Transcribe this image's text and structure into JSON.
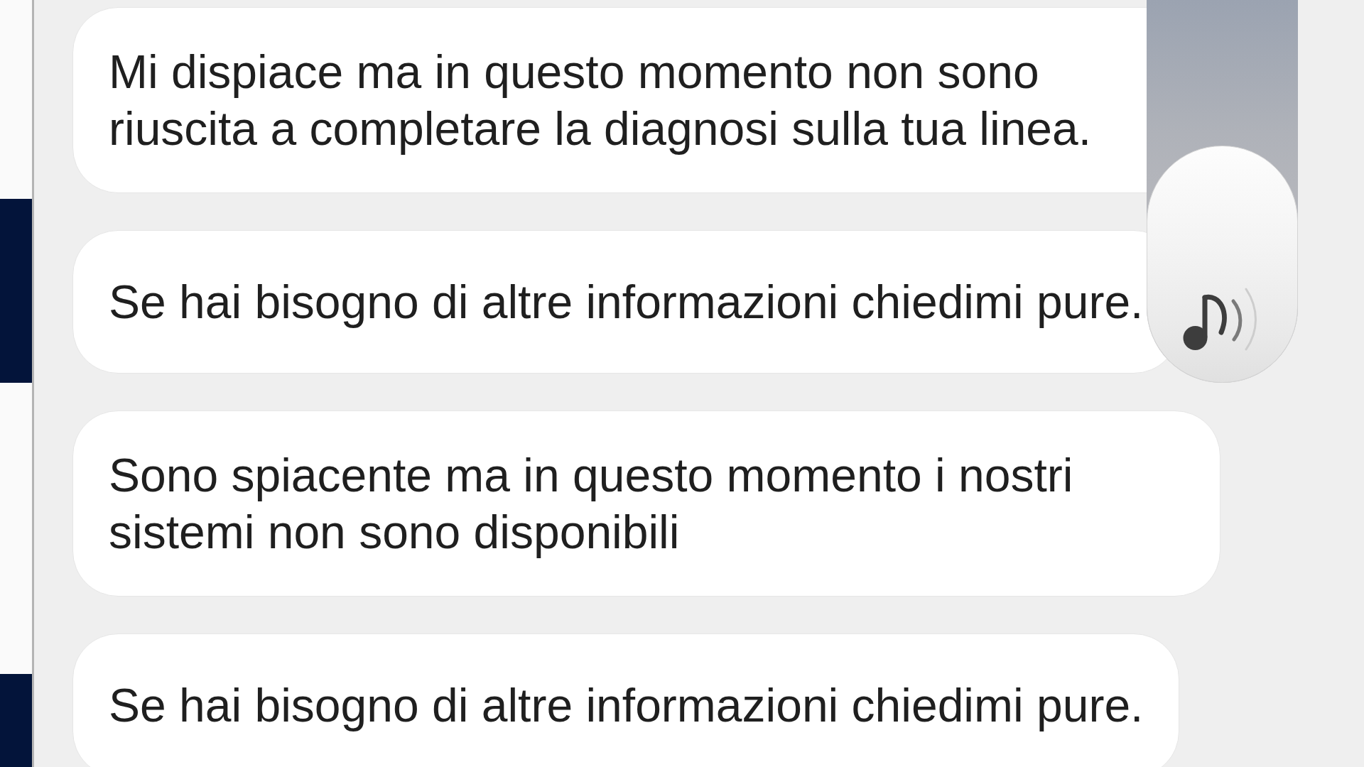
{
  "chat": {
    "messages": [
      {
        "text": "Mi dispiace ma in questo momento non sono riuscita a completare la diagnosi sulla tua linea."
      },
      {
        "text": "Se hai bisogno di altre informazioni chiedimi pure."
      },
      {
        "text": "Sono spiacente ma in questo momento i nostri sistemi non sono disponibili"
      },
      {
        "text": "Se hai bisogno di altre informazioni chiedimi pure."
      }
    ]
  }
}
